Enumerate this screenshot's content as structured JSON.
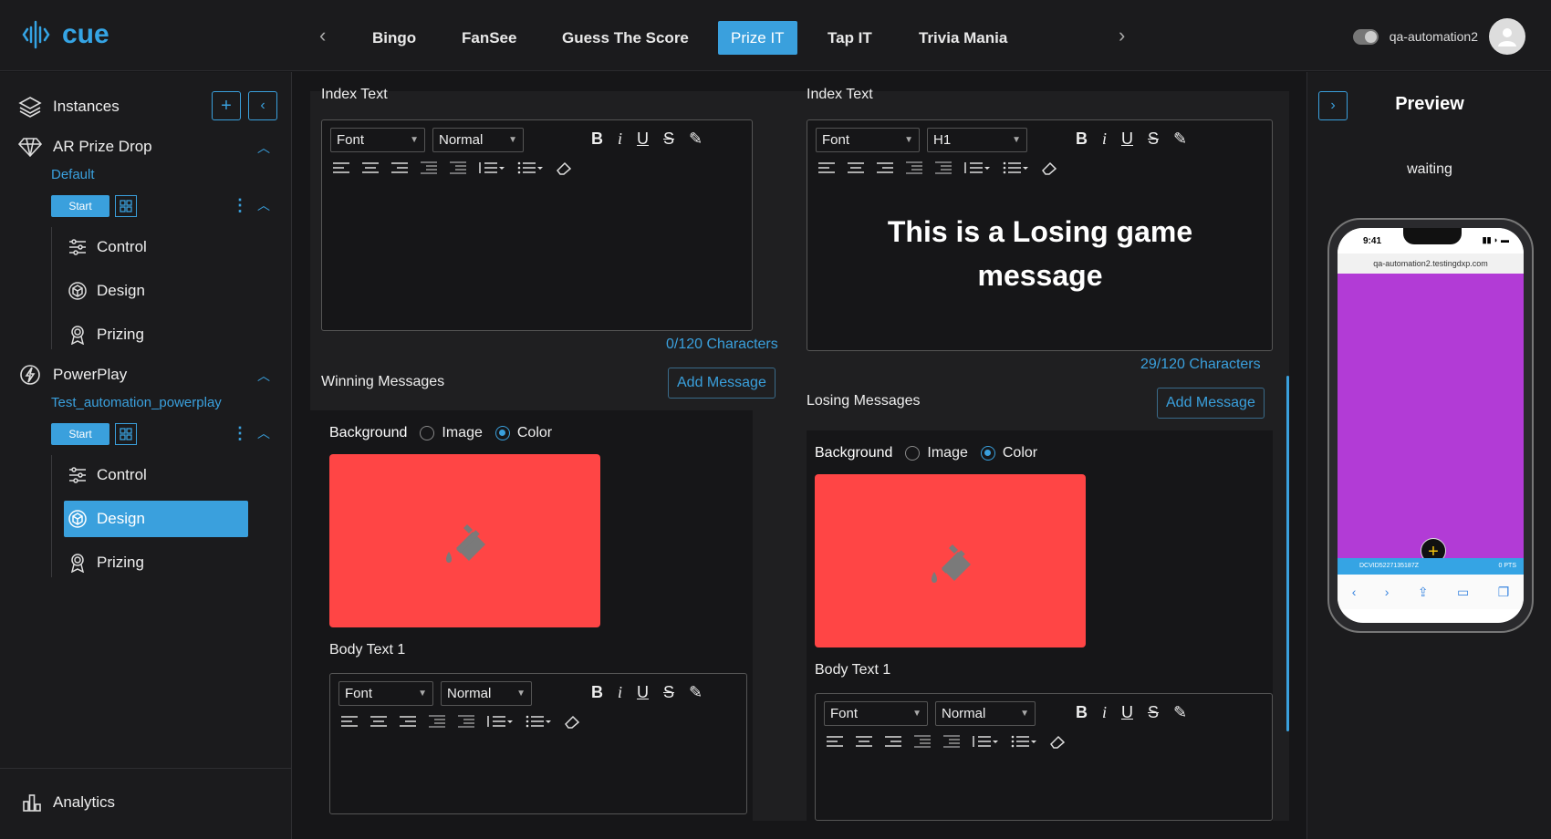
{
  "app": {
    "logo_text": "cue",
    "brand_color": "#35a4e4"
  },
  "nav": {
    "tabs": [
      {
        "label": "Bingo"
      },
      {
        "label": "FanSee"
      },
      {
        "label": "Guess The Score"
      },
      {
        "label": "Prize IT",
        "active": true
      },
      {
        "label": "Tap IT"
      },
      {
        "label": "Trivia Mania"
      }
    ],
    "prev_icon": "chevron-left-icon",
    "next_icon": "chevron-right-icon"
  },
  "user": {
    "name": "qa-automation2"
  },
  "sidebar": {
    "instances_label": "Instances",
    "groups": [
      {
        "title": "AR Prize Drop",
        "subtitle": "Default",
        "start_label": "Start",
        "items": [
          {
            "label": "Control"
          },
          {
            "label": "Design"
          },
          {
            "label": "Prizing"
          }
        ]
      },
      {
        "title": "PowerPlay",
        "subtitle": "Test_automation_powerplay",
        "start_label": "Start",
        "items": [
          {
            "label": "Control"
          },
          {
            "label": "Design",
            "active": true
          },
          {
            "label": "Prizing"
          }
        ]
      }
    ],
    "analytics_label": "Analytics"
  },
  "left": {
    "index_label": "Index Text",
    "font": "Font",
    "size": "Normal",
    "count": "0/120 Characters",
    "section_label": "Winning Messages",
    "add_label": "Add Message",
    "background_label": "Background",
    "image_option": "Image",
    "color_option": "Color",
    "swatch_color": "#ff4545",
    "body_label": "Body Text 1",
    "body_font": "Font",
    "body_size": "Normal"
  },
  "right": {
    "index_label": "Index Text",
    "font": "Font",
    "size": "H1",
    "message": "This is a Losing game message",
    "count": "29/120 Characters",
    "section_label": "Losing Messages",
    "add_label": "Add Message",
    "background_label": "Background",
    "image_option": "Image",
    "color_option": "Color",
    "swatch_color": "#ff4545",
    "body_label": "Body Text 1",
    "body_font": "Font",
    "body_size": "Normal"
  },
  "preview": {
    "title": "Preview",
    "status": "waiting",
    "phone_time": "9:41",
    "url": "qa-automation2.testingdxp.com",
    "screen_color": "#b23bd6",
    "footer_left": "DCVID5227135187Z",
    "footer_right": "0 PTS"
  }
}
